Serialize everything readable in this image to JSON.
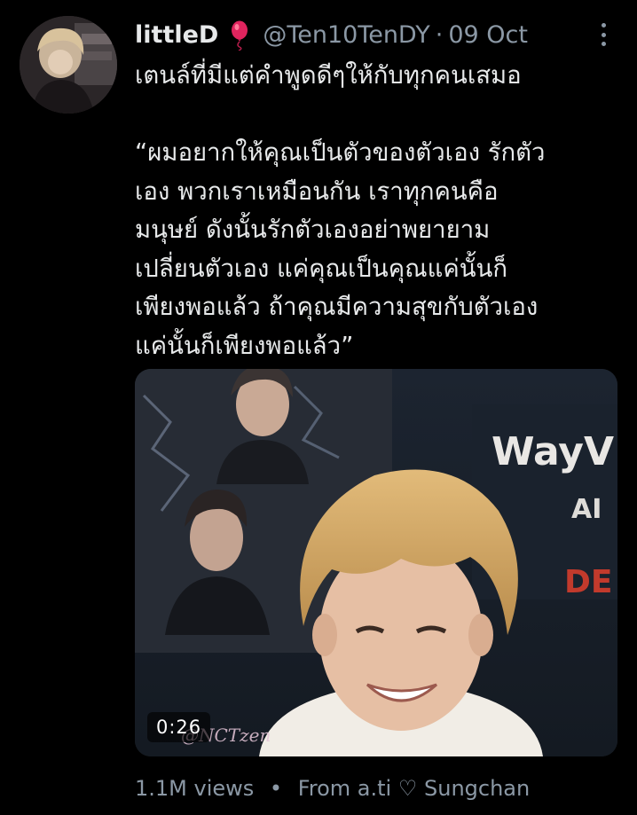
{
  "tweet": {
    "author": {
      "display_name": "littleD",
      "badge_icon": "balloon-icon",
      "handle": "@Ten10TenDY",
      "separator": "·",
      "date": "09 Oct"
    },
    "more_icon": "more-vertical-icon",
    "text": {
      "line1": "เตนล์ที่มีแต่คำพูดดีๆให้กับทุกคนเสมอ",
      "quote_lines": [
        "“ผมอยากให้คุณเป็นตัวของตัวเอง รักตัว",
        "เอง พวกเราเหมือนกัน เราทุกคนคือ",
        "มนุษย์ ดังนั้นรักตัวเองอย่าพยายาม",
        "เปลี่ยนตัวเอง แค่คุณเป็นคุณแค่นั้นก็",
        "เพียงพอแล้ว  ถ้าคุณมีความสุขกับตัวเอง",
        "แค่นั้นก็เพียงพอแล้ว”"
      ]
    },
    "media": {
      "type": "video",
      "duration": "0:26",
      "sign_text": "WayV",
      "sign_sub_text": "AI",
      "sign_sub_text2": "DE",
      "watermark": "@NCTzen"
    },
    "footer": {
      "views": "1.1M views",
      "separator": "•",
      "from_label": "From a.ti ♡ Sungchan"
    },
    "colors": {
      "background": "#000000",
      "primary_text": "#e7e9ea",
      "secondary_text": "#8b98a5",
      "badge_red": "#e0245e"
    }
  }
}
